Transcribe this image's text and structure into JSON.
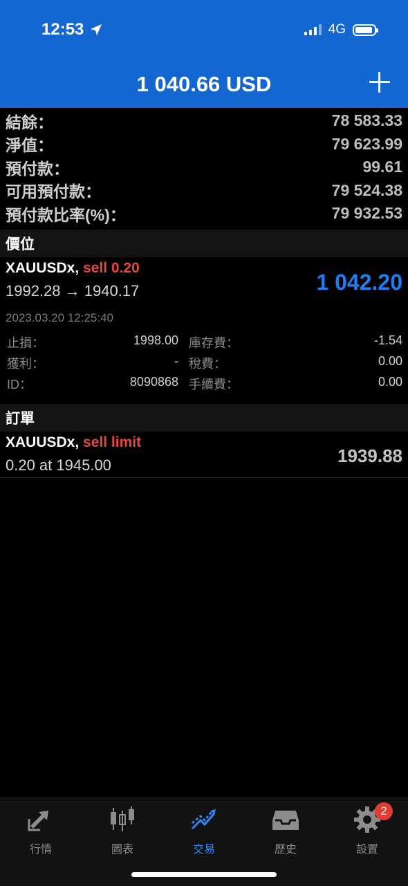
{
  "status_bar": {
    "time": "12:53",
    "network": "4G"
  },
  "header": {
    "balance_title": "1 040.66 USD"
  },
  "summary": [
    {
      "label": "結餘：",
      "value": "78 583.33"
    },
    {
      "label": "淨值：",
      "value": "79 623.99"
    },
    {
      "label": "預付款：",
      "value": "99.61"
    },
    {
      "label": "可用預付款：",
      "value": "79 524.38"
    },
    {
      "label": "預付款比率(%)：",
      "value": "79 932.53"
    }
  ],
  "positions_section": {
    "title": "價位"
  },
  "position": {
    "symbol": "XAUUSDx,",
    "side": "sell 0.20",
    "prices": "1992.28 → 1940.17",
    "profit": "1 042.20",
    "time": "2023.03.20 12:25:40",
    "details": [
      {
        "label1": "止損：",
        "value1": "1998.00",
        "label2": "庫存費：",
        "value2": "-1.54"
      },
      {
        "label1": "獲利：",
        "value1": "-",
        "label2": "稅費：",
        "value2": "0.00"
      },
      {
        "label1": "ID：",
        "value1": "8090868",
        "label2": "手續費：",
        "value2": "0.00"
      }
    ]
  },
  "orders_section": {
    "title": "訂單"
  },
  "order": {
    "symbol": "XAUUSDx,",
    "side": "sell limit",
    "desc": "0.20 at 1945.00",
    "price": "1939.88"
  },
  "tabs": [
    {
      "label": "行情",
      "icon": "quotes-icon"
    },
    {
      "label": "圖表",
      "icon": "chart-icon"
    },
    {
      "label": "交易",
      "icon": "trade-icon",
      "active": true
    },
    {
      "label": "歷史",
      "icon": "history-icon"
    },
    {
      "label": "設置",
      "icon": "settings-icon",
      "badge": "2"
    }
  ],
  "colors": {
    "header": "#1466d1",
    "profit": "#1e7ef5",
    "sell": "#e8473c",
    "active_tab": "#2f86f2",
    "badge": "#e23b32"
  }
}
